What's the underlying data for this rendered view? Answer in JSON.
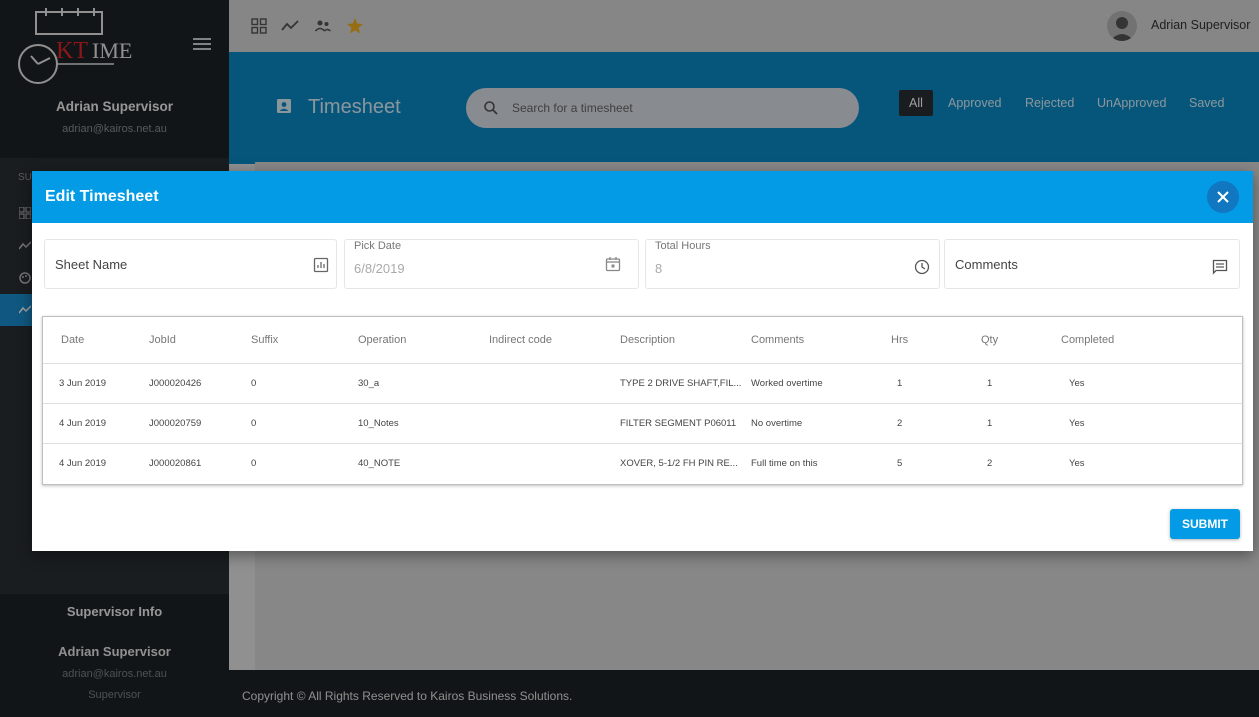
{
  "sidebar": {
    "logo_text": "KTIME",
    "user_name": "Adrian Supervisor",
    "user_email": "adrian@kairos.net.au",
    "section_label": "SU",
    "info_title": "Supervisor Info",
    "info_name": "Adrian Supervisor",
    "info_email": "adrian@kairos.net.au",
    "info_role": "Supervisor"
  },
  "topbar": {
    "icons": [
      "dashboard-icon",
      "trend-icon",
      "people-icon",
      "star-icon"
    ],
    "user_name": "Adrian Supervisor"
  },
  "header": {
    "title": "Timesheet",
    "search_placeholder": "Search for a timesheet",
    "filters": [
      "All",
      "Approved",
      "Rejected",
      "UnApproved",
      "Saved"
    ],
    "active_filter": "All"
  },
  "footer": {
    "text": "Copyright © All Rights Reserved to Kairos Business Solutions."
  },
  "modal": {
    "title": "Edit Timesheet",
    "fields": {
      "sheet_name_placeholder": "Sheet Name",
      "pick_date_label": "Pick Date",
      "pick_date_value": "6/8/2019",
      "total_hours_label": "Total Hours",
      "total_hours_value": "8",
      "comments_placeholder": "Comments"
    },
    "table": {
      "columns": [
        "Date",
        "JobId",
        "Suffix",
        "Operation",
        "Indirect code",
        "Description",
        "Comments",
        "Hrs",
        "Qty",
        "Completed"
      ],
      "rows": [
        [
          "3 Jun 2019",
          "J000020426",
          "0",
          "30_a",
          "",
          "TYPE 2 DRIVE SHAFT,FIL...",
          "Worked overtime",
          "1",
          "1",
          "Yes"
        ],
        [
          "4 Jun 2019",
          "J000020759",
          "0",
          "10_Notes",
          "",
          "FILTER SEGMENT P06011",
          "No overtime",
          "2",
          "1",
          "Yes"
        ],
        [
          "4 Jun 2019",
          "J000020861",
          "0",
          "40_NOTE",
          "",
          "XOVER, 5-1/2 FH PIN RE...",
          "Full time on this",
          "5",
          "2",
          "Yes"
        ]
      ]
    },
    "submit_label": "SUBMIT"
  },
  "colors": {
    "accent": "#039be5",
    "header_blue": "#0b8cc9",
    "sidebar_dark": "#1e2226",
    "star": "#f2b01e"
  }
}
